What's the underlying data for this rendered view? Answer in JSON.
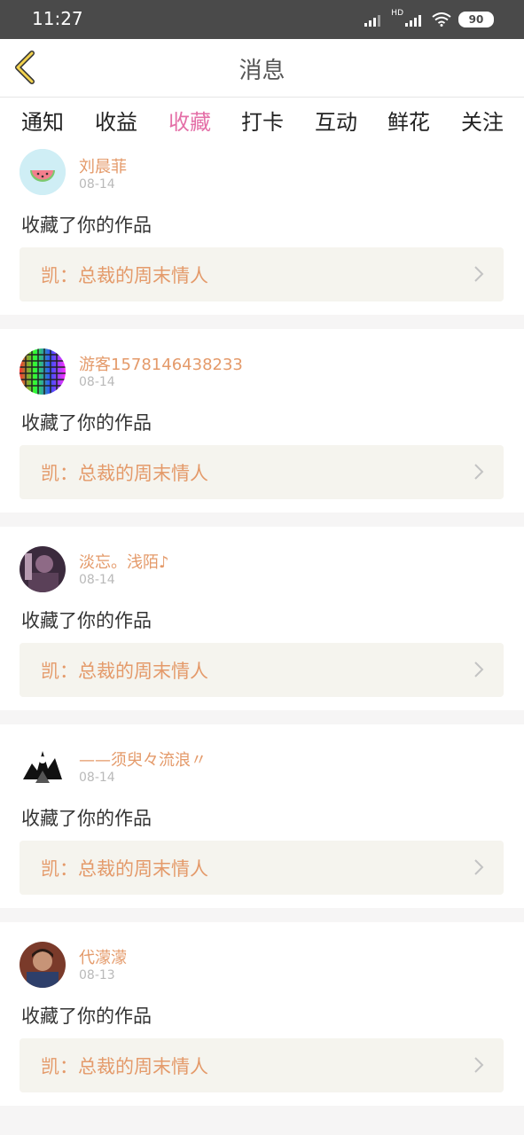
{
  "status_bar": {
    "time": "11:27",
    "network": "HD",
    "battery": "90"
  },
  "header": {
    "title": "消息"
  },
  "tabs": [
    {
      "label": "通知"
    },
    {
      "label": "收益"
    },
    {
      "label": "收藏",
      "active": true
    },
    {
      "label": "打卡"
    },
    {
      "label": "互动"
    },
    {
      "label": "鲜花"
    },
    {
      "label": "关注"
    }
  ],
  "messages": [
    {
      "user": "刘晨菲",
      "date": "08-14",
      "action": "收藏了你的作品",
      "work_title": "凯：总裁的周末情人",
      "avatar_icon": "watermelon-avatar"
    },
    {
      "user": "游客1578146438233",
      "date": "08-14",
      "action": "收藏了你的作品",
      "work_title": "凯：总裁的周末情人",
      "avatar_icon": "color-grid-avatar"
    },
    {
      "user": "淡忘。浅陌♪",
      "date": "08-14",
      "action": "收藏了你的作品",
      "work_title": "凯：总裁的周末情人",
      "avatar_icon": "photo-avatar"
    },
    {
      "user": "——须臾々流浪〃",
      "date": "08-14",
      "action": "收藏了你的作品",
      "work_title": "凯：总裁的周末情人",
      "avatar_icon": "ink-sketch-avatar"
    },
    {
      "user": "代濛濛",
      "date": "08-13",
      "action": "收藏了你的作品",
      "work_title": "凯：总裁的周末情人",
      "avatar_icon": "photo-avatar"
    }
  ],
  "colors": {
    "accent": "#e46fa7",
    "username": "#e49a6a",
    "work_bg": "#f5f4ee",
    "status_bar": "#4a4a4a"
  }
}
